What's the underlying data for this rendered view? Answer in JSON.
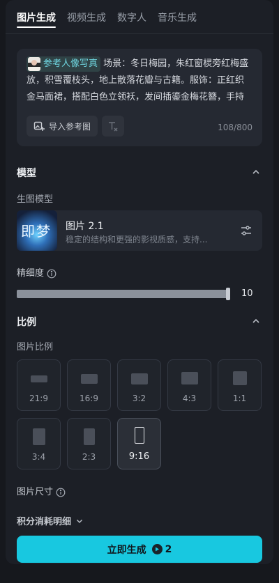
{
  "tabs": [
    {
      "label": "图片生成",
      "active": true
    },
    {
      "label": "视频生成",
      "active": false
    },
    {
      "label": "数字人",
      "active": false
    },
    {
      "label": "音乐生成",
      "active": false
    }
  ],
  "prompt": {
    "reference_chip": "参考人像写真",
    "text": " 场景：冬日梅园，朱红窗棂旁红梅盛放，积雪覆枝头，地上散落花瓣与古籍。服饰：正红织金马面裙，搭配白色立领袄，发间插鎏金梅花簪，手持红绸伞。光影：夕阳逆光穿透窗棂",
    "import_label": "导入参考图",
    "counter": "108/800"
  },
  "model_section": {
    "title": "模型",
    "sub_label": "生图模型",
    "model_name": "图片 2.1",
    "model_desc": "稳定的结构和更强的影视质感，支持...",
    "thumb_text": "即梦"
  },
  "detail": {
    "label": "精细度",
    "value": "10",
    "fraction": 1.0
  },
  "ratio_section": {
    "title": "比例",
    "sub_label": "图片比例",
    "options": [
      {
        "label": "21:9",
        "active": false
      },
      {
        "label": "16:9",
        "active": false
      },
      {
        "label": "3:2",
        "active": false
      },
      {
        "label": "4:3",
        "active": false
      },
      {
        "label": "1:1",
        "active": false
      },
      {
        "label": "3:4",
        "active": false
      },
      {
        "label": "2:3",
        "active": false
      },
      {
        "label": "9:16",
        "active": true
      }
    ],
    "size_label": "图片尺寸"
  },
  "points_detail": "积分消耗明细",
  "generate": {
    "label": "立即生成",
    "cost": "2",
    "color": "#18c8e0"
  }
}
